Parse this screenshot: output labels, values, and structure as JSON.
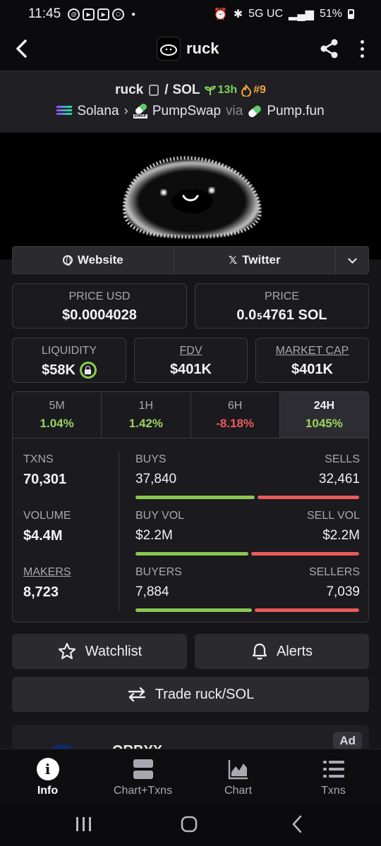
{
  "status_bar": {
    "time": "11:45",
    "network": "5G UC",
    "battery": "51%"
  },
  "app_bar": {
    "title": "ruck"
  },
  "pair": {
    "base": "ruck",
    "separator": "/",
    "quote": "SOL",
    "age": "13h",
    "rank": "#9",
    "chain": "Solana",
    "dex": "PumpSwap",
    "via_label": "via",
    "launchpad": "Pump.fun"
  },
  "links": {
    "website": "Website",
    "twitter": "Twitter"
  },
  "price": {
    "usd_label": "PRICE USD",
    "usd_value": "$0.0004028",
    "native_label": "PRICE",
    "native_prefix": "0.0",
    "native_zeros": "5",
    "native_digits": "4761 SOL"
  },
  "metrics": {
    "liquidity_label": "LIQUIDITY",
    "liquidity_value": "$58K",
    "fdv_label": "FDV",
    "fdv_value": "$401K",
    "mcap_label": "MARKET CAP",
    "mcap_value": "$401K"
  },
  "timeframes": [
    {
      "label": "5M",
      "value": "1.04%"
    },
    {
      "label": "1H",
      "value": "1.42%"
    },
    {
      "label": "6H",
      "value": "-8.18%"
    },
    {
      "label": "24H",
      "value": "1045%"
    }
  ],
  "stats": {
    "txns_label": "TXNS",
    "txns_value": "70,301",
    "buys_label": "BUYS",
    "buys_value": "37,840",
    "sells_label": "SELLS",
    "sells_value": "32,461",
    "buy_share": 0.538,
    "volume_label": "VOLUME",
    "volume_value": "$4.4M",
    "buyvol_label": "BUY VOL",
    "buyvol_value": "$2.2M",
    "sellvol_label": "SELL VOL",
    "sellvol_value": "$2.2M",
    "buyvol_share": 0.51,
    "makers_label": "MAKERS",
    "makers_value": "8,723",
    "buyers_label": "BUYERS",
    "buyers_value": "7,884",
    "sellers_label": "SELLERS",
    "sellers_value": "7,039",
    "buyers_share": 0.528
  },
  "actions": {
    "watchlist": "Watchlist",
    "alerts": "Alerts",
    "trade": "Trade ruck/SOL"
  },
  "ad": {
    "badge": "Ad",
    "name": "QRBYX"
  },
  "bottom_nav": [
    {
      "label": "Info",
      "icon": "info-icon"
    },
    {
      "label": "Chart+Txns",
      "icon": "chart-txns-icon"
    },
    {
      "label": "Chart",
      "icon": "area-chart-icon"
    },
    {
      "label": "Txns",
      "icon": "list-icon"
    }
  ],
  "colors": {
    "positive": "#9bd45e",
    "negative": "#f05a5a",
    "buy_bar": "#8bc752",
    "sell_bar": "#e85a5a"
  }
}
